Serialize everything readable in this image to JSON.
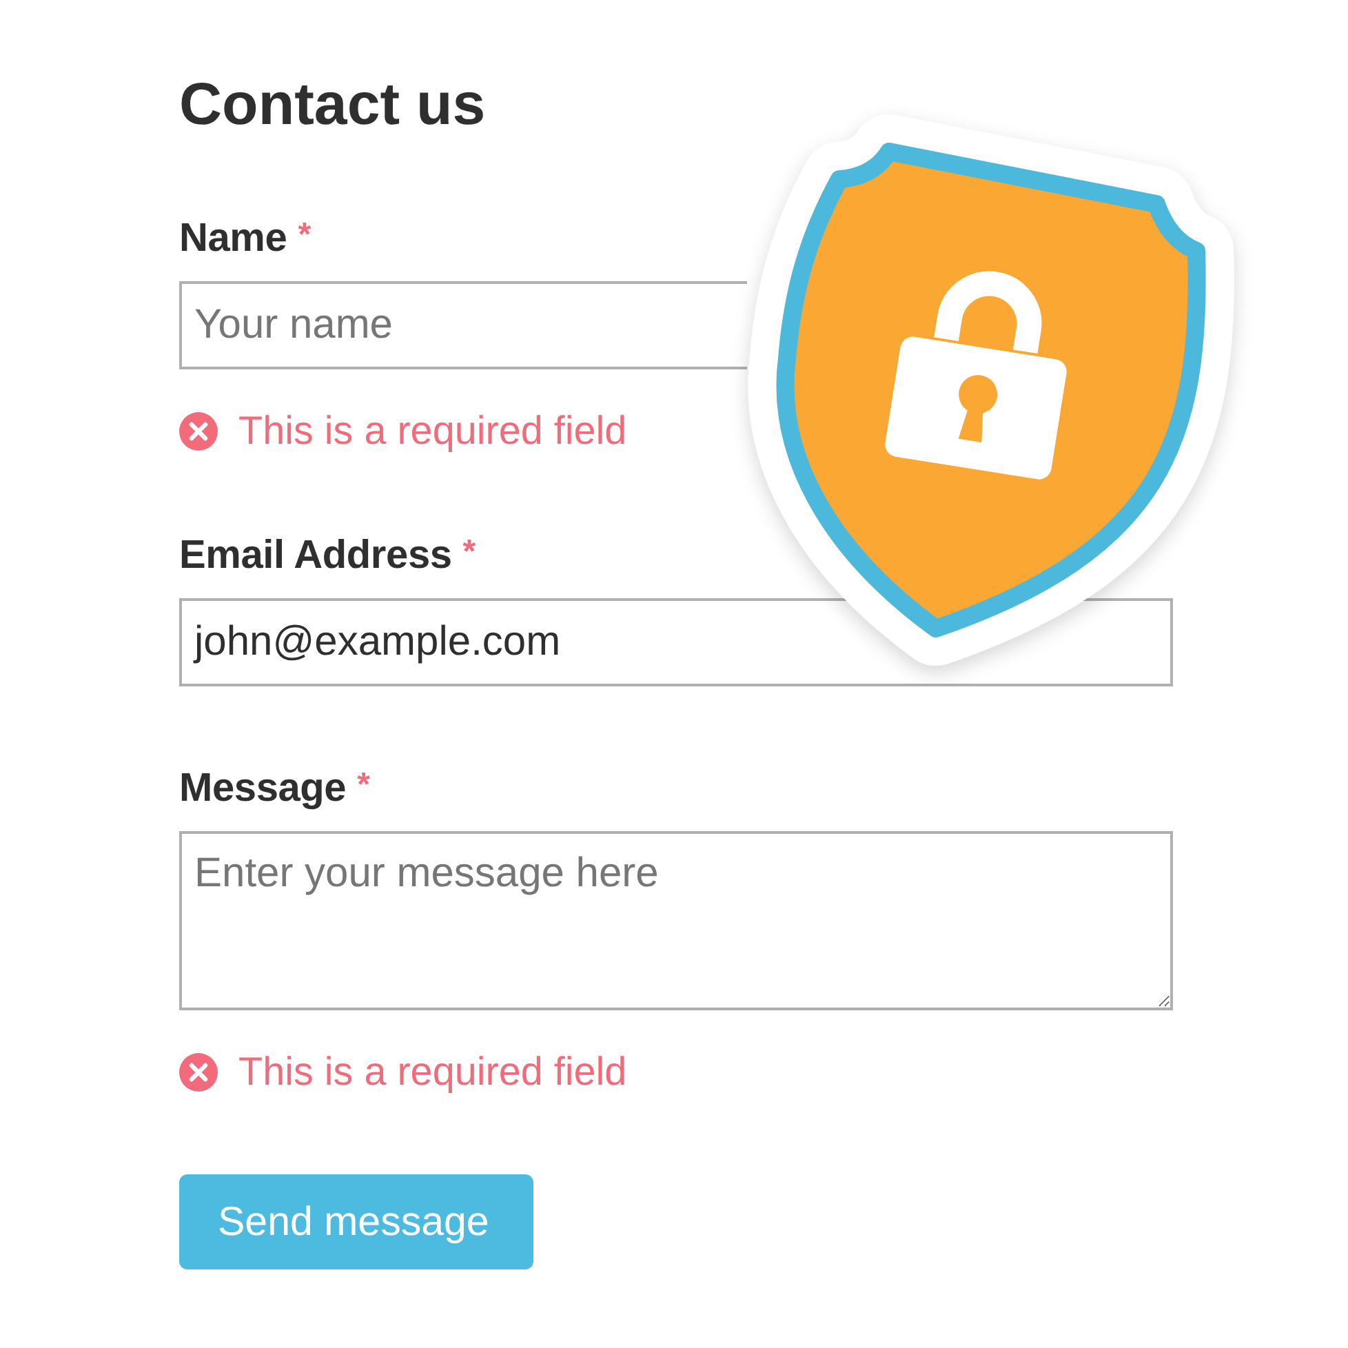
{
  "title": "Contact us",
  "fields": [
    {
      "kind": "input",
      "label": "Name",
      "required_mark": "*",
      "placeholder": "Your name",
      "error": "This is a required field"
    },
    {
      "kind": "input",
      "label": "Email Address",
      "required_mark": "*",
      "value": "john@example.com"
    },
    {
      "kind": "textarea",
      "label": "Message",
      "required_mark": "*",
      "placeholder": "Enter your message here",
      "error": "This is a required field"
    }
  ],
  "submit": {
    "label": "Send message"
  }
}
